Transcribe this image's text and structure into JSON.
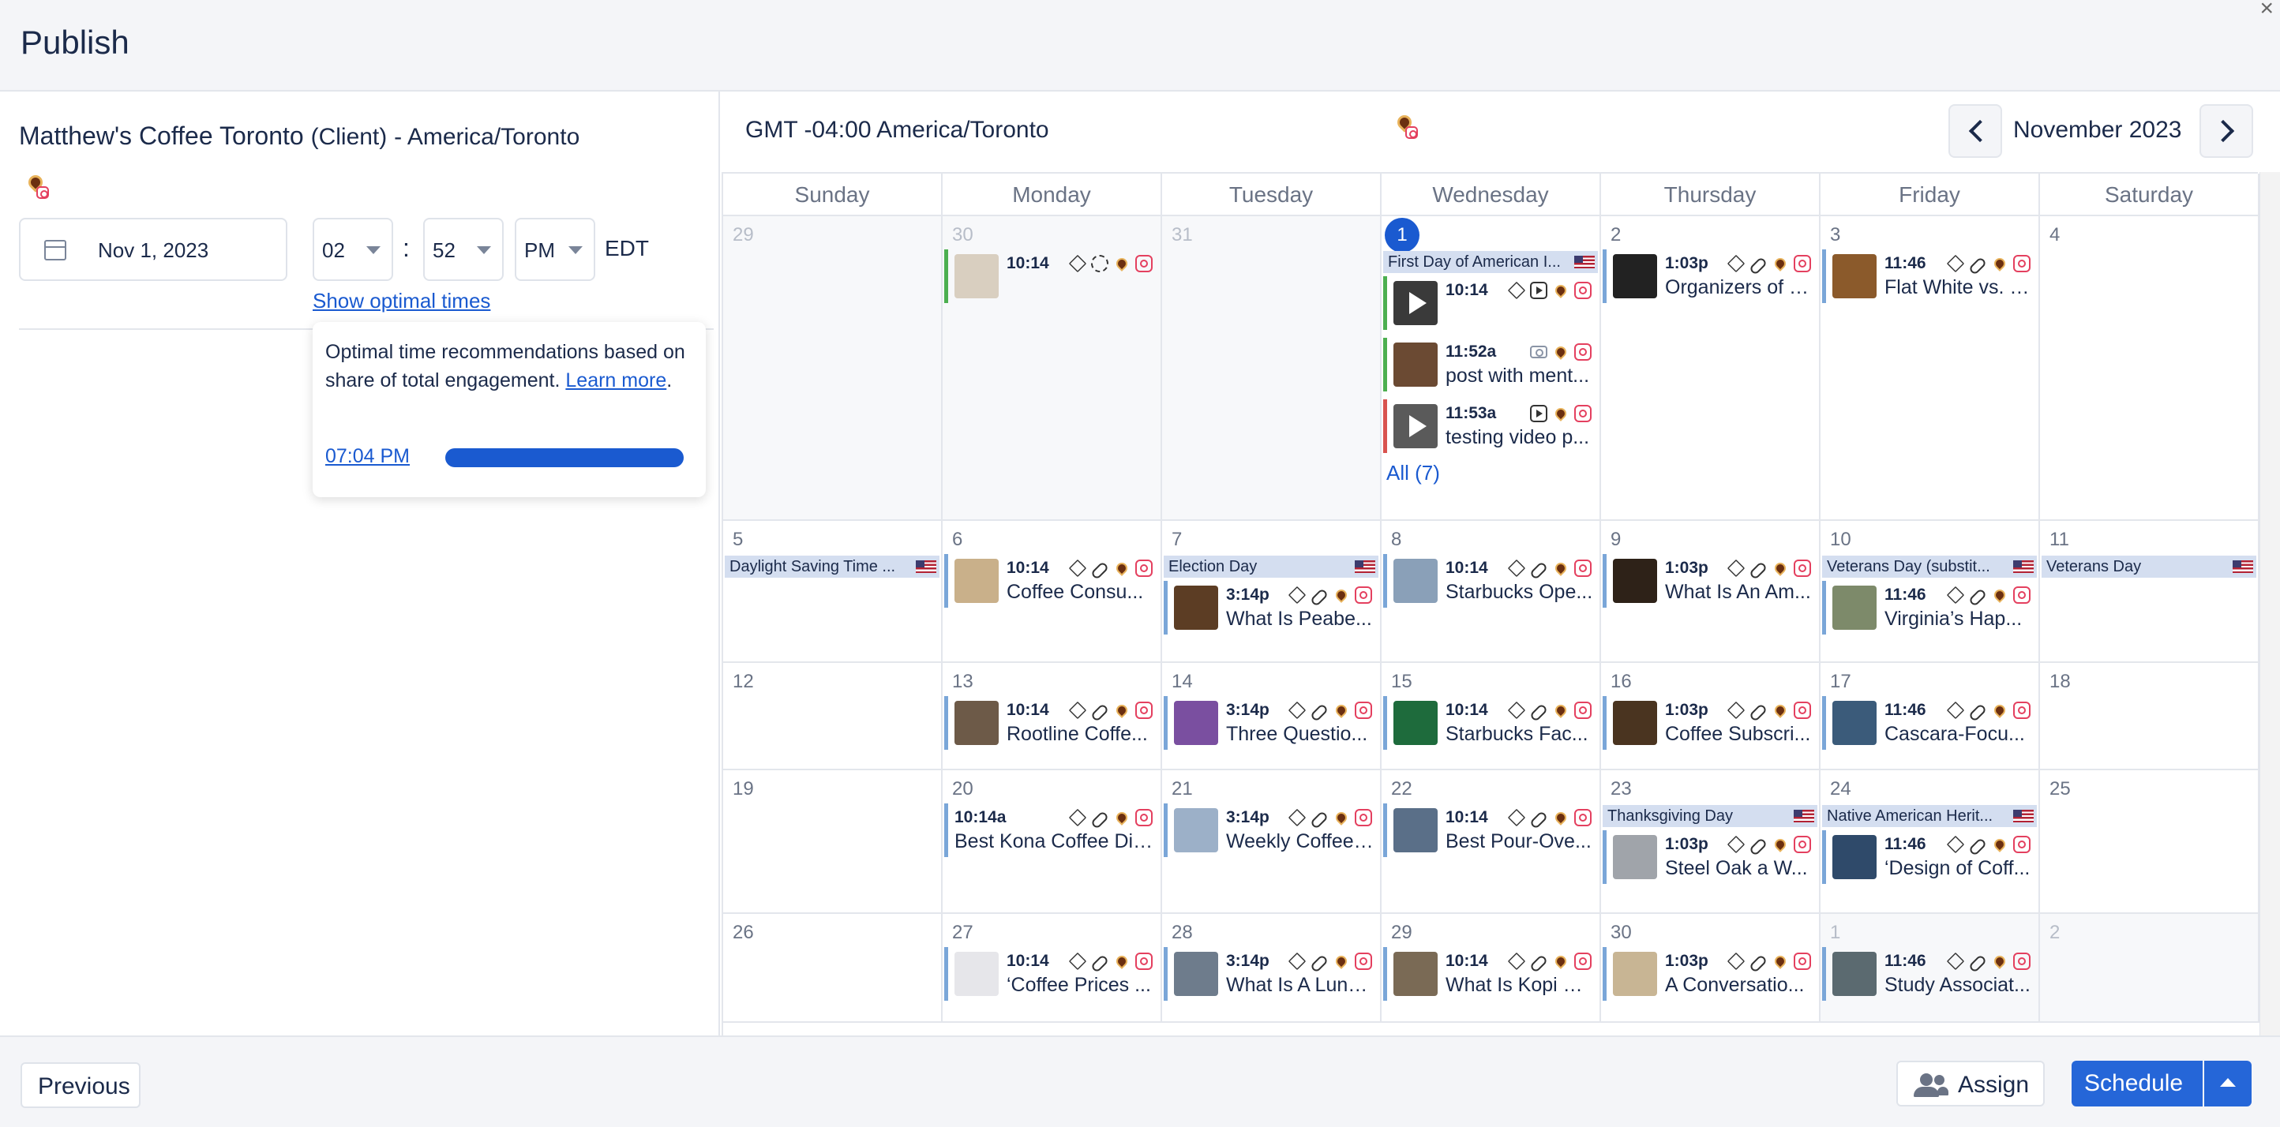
{
  "header": {
    "title": "Publish",
    "close_icon": "close-icon"
  },
  "client": {
    "name": "Matthew's Coffee Toronto",
    "role": "(Client)",
    "timezone": "- America/Toronto"
  },
  "schedule": {
    "date": "Nov 1, 2023",
    "hour": "02",
    "minute": "52",
    "ampm": "PM",
    "tz": "EDT",
    "show_optimal": "Show optimal times"
  },
  "optimal": {
    "text": "Optimal time recommendations based on share of total engagement.",
    "learn_more": "Learn more",
    "time": "07:04 PM",
    "level": 1.0
  },
  "calendar": {
    "tz_label": "GMT -04:00 America/Toronto",
    "month": "November 2023",
    "days": [
      "Sunday",
      "Monday",
      "Tuesday",
      "Wednesday",
      "Thursday",
      "Friday",
      "Saturday"
    ],
    "all_more": "All (7)",
    "weeks": [
      [
        {
          "d": "29",
          "out": true,
          "items": []
        },
        {
          "d": "30",
          "out": true,
          "items": [
            {
              "type": "post",
              "time": "10:14",
              "title": "",
              "icons": [
                "layers",
                "loader",
                "brand",
                "ig"
              ],
              "bar": "green",
              "thumb": "#d9cfc0"
            }
          ]
        },
        {
          "d": "31",
          "out": true,
          "items": []
        },
        {
          "d": "1",
          "today": true,
          "items": [
            {
              "type": "holiday",
              "title": "First Day of American I..."
            },
            {
              "type": "post",
              "time": "10:14",
              "title": "",
              "icons": [
                "layers",
                "reel",
                "brand",
                "ig"
              ],
              "bar": "green",
              "thumb": "#3a3a3a",
              "video": true
            },
            {
              "type": "post",
              "time": "11:52a",
              "title": "post with ment...",
              "icons": [
                "camera",
                "brand",
                "ig"
              ],
              "bar": "green",
              "thumb": "#6b4a33"
            },
            {
              "type": "post",
              "time": "11:53a",
              "title": "testing video p...",
              "icons": [
                "reel",
                "brand",
                "ig"
              ],
              "bar": "red",
              "thumb": "#5a5a5a",
              "video": true
            },
            {
              "type": "more"
            }
          ]
        },
        {
          "d": "2",
          "items": [
            {
              "type": "post",
              "time": "1:03p",
              "title": "Organizers of S...",
              "icons": [
                "layers",
                "link",
                "brand",
                "ig"
              ],
              "bar": "blue",
              "thumb": "#222"
            }
          ]
        },
        {
          "d": "3",
          "items": [
            {
              "type": "post",
              "time": "11:46",
              "title": "Flat White vs. L...",
              "icons": [
                "layers",
                "link",
                "brand",
                "ig"
              ],
              "bar": "blue",
              "thumb": "#8b5a2b"
            }
          ]
        },
        {
          "d": "4",
          "items": []
        }
      ],
      [
        {
          "d": "5",
          "items": [
            {
              "type": "holiday",
              "title": "Daylight Saving Time ..."
            }
          ]
        },
        {
          "d": "6",
          "items": [
            {
              "type": "post",
              "time": "10:14",
              "title": "Coffee Consu...",
              "icons": [
                "layers",
                "link",
                "brand",
                "ig"
              ],
              "bar": "blue",
              "thumb": "#c9b08a"
            }
          ]
        },
        {
          "d": "7",
          "items": [
            {
              "type": "holiday",
              "title": "Election Day"
            },
            {
              "type": "post",
              "time": "3:14p",
              "title": "What Is Peabe...",
              "icons": [
                "layers",
                "link",
                "brand",
                "ig"
              ],
              "bar": "blue",
              "thumb": "#5c3d24"
            }
          ]
        },
        {
          "d": "8",
          "items": [
            {
              "type": "post",
              "time": "10:14",
              "title": "Starbucks Ope...",
              "icons": [
                "layers",
                "link",
                "brand",
                "ig"
              ],
              "bar": "blue",
              "thumb": "#8aa0b8"
            }
          ]
        },
        {
          "d": "9",
          "items": [
            {
              "type": "post",
              "time": "1:03p",
              "title": "What Is An Am...",
              "icons": [
                "layers",
                "link",
                "brand",
                "ig"
              ],
              "bar": "blue",
              "thumb": "#2e2218"
            }
          ]
        },
        {
          "d": "10",
          "items": [
            {
              "type": "holiday",
              "title": "Veterans Day (substit..."
            },
            {
              "type": "post",
              "time": "11:46",
              "title": "Virginia’s Hap...",
              "icons": [
                "layers",
                "link",
                "brand",
                "ig"
              ],
              "bar": "blue",
              "thumb": "#7d8a6a"
            }
          ]
        },
        {
          "d": "11",
          "items": [
            {
              "type": "holiday",
              "title": "Veterans Day"
            }
          ]
        }
      ],
      [
        {
          "d": "12",
          "items": []
        },
        {
          "d": "13",
          "items": [
            {
              "type": "post",
              "time": "10:14",
              "title": "Rootline Coffe...",
              "icons": [
                "layers",
                "link",
                "brand",
                "ig"
              ],
              "bar": "blue",
              "thumb": "#6d5a48"
            }
          ]
        },
        {
          "d": "14",
          "items": [
            {
              "type": "post",
              "time": "3:14p",
              "title": "Three Questio...",
              "icons": [
                "layers",
                "link",
                "brand",
                "ig"
              ],
              "bar": "blue",
              "thumb": "#7a4fa0"
            }
          ]
        },
        {
          "d": "15",
          "items": [
            {
              "type": "post",
              "time": "10:14",
              "title": "Starbucks Fac...",
              "icons": [
                "layers",
                "link",
                "brand",
                "ig"
              ],
              "bar": "blue",
              "thumb": "#1e6b3c"
            }
          ]
        },
        {
          "d": "16",
          "items": [
            {
              "type": "post",
              "time": "1:03p",
              "title": "Coffee Subscri...",
              "icons": [
                "layers",
                "link",
                "brand",
                "ig"
              ],
              "bar": "blue",
              "thumb": "#4a3420"
            }
          ]
        },
        {
          "d": "17",
          "items": [
            {
              "type": "post",
              "time": "11:46",
              "title": "Cascara-Focu...",
              "icons": [
                "layers",
                "link",
                "brand",
                "ig"
              ],
              "bar": "blue",
              "thumb": "#3b5b7a"
            }
          ]
        },
        {
          "d": "18",
          "items": []
        }
      ],
      [
        {
          "d": "19",
          "items": []
        },
        {
          "d": "20",
          "items": [
            {
              "type": "post",
              "time": "10:14a",
              "title": "Best Kona Coffee Dir...",
              "icons": [
                "layers",
                "link",
                "brand",
                "ig"
              ],
              "bar": "blue",
              "nothumb": true
            }
          ]
        },
        {
          "d": "21",
          "items": [
            {
              "type": "post",
              "time": "3:14p",
              "title": "Weekly Coffee ...",
              "icons": [
                "layers",
                "link",
                "brand",
                "ig"
              ],
              "bar": "blue",
              "thumb": "#9cb0c8"
            }
          ]
        },
        {
          "d": "22",
          "items": [
            {
              "type": "post",
              "time": "10:14",
              "title": "Best Pour-Ove...",
              "icons": [
                "layers",
                "link",
                "brand",
                "ig"
              ],
              "bar": "blue",
              "thumb": "#5a6f88"
            }
          ]
        },
        {
          "d": "23",
          "items": [
            {
              "type": "holiday",
              "title": "Thanksgiving Day"
            },
            {
              "type": "post",
              "time": "1:03p",
              "title": "Steel Oak a W...",
              "icons": [
                "layers",
                "link",
                "brand",
                "ig"
              ],
              "bar": "blue",
              "thumb": "#a0a4aa"
            }
          ]
        },
        {
          "d": "24",
          "items": [
            {
              "type": "holiday",
              "title": "Native American Herit..."
            },
            {
              "type": "post",
              "time": "11:46",
              "title": "‘Design of Coff...",
              "icons": [
                "layers",
                "link",
                "brand",
                "ig"
              ],
              "bar": "blue",
              "thumb": "#2f4a6a"
            }
          ]
        },
        {
          "d": "25",
          "items": []
        }
      ],
      [
        {
          "d": "26",
          "items": []
        },
        {
          "d": "27",
          "items": [
            {
              "type": "post",
              "time": "10:14",
              "title": "‘Coffee Prices ...",
              "icons": [
                "layers",
                "link",
                "brand",
                "ig"
              ],
              "bar": "blue",
              "thumb": "#e6e6ea"
            }
          ]
        },
        {
          "d": "28",
          "items": [
            {
              "type": "post",
              "time": "3:14p",
              "title": "What Is A Lung...",
              "icons": [
                "layers",
                "link",
                "brand",
                "ig"
              ],
              "bar": "blue",
              "thumb": "#6e7c8c"
            }
          ]
        },
        {
          "d": "29",
          "items": [
            {
              "type": "post",
              "time": "10:14",
              "title": "What Is Kopi Lu...",
              "icons": [
                "layers",
                "link",
                "brand",
                "ig"
              ],
              "bar": "blue",
              "thumb": "#7a6a55"
            }
          ]
        },
        {
          "d": "30",
          "items": [
            {
              "type": "post",
              "time": "1:03p",
              "title": "A Conversatio...",
              "icons": [
                "layers",
                "link",
                "brand",
                "ig"
              ],
              "bar": "blue",
              "thumb": "#c8b594"
            }
          ]
        },
        {
          "d": "1",
          "out": true,
          "items": [
            {
              "type": "post",
              "time": "11:46",
              "title": "Study Associat...",
              "icons": [
                "layers",
                "link",
                "brand",
                "ig"
              ],
              "bar": "blue",
              "thumb": "#5b6a70"
            }
          ]
        },
        {
          "d": "2",
          "out": true,
          "items": []
        }
      ]
    ]
  },
  "footer": {
    "previous": "Previous",
    "assign": "Assign",
    "schedule": "Schedule"
  }
}
